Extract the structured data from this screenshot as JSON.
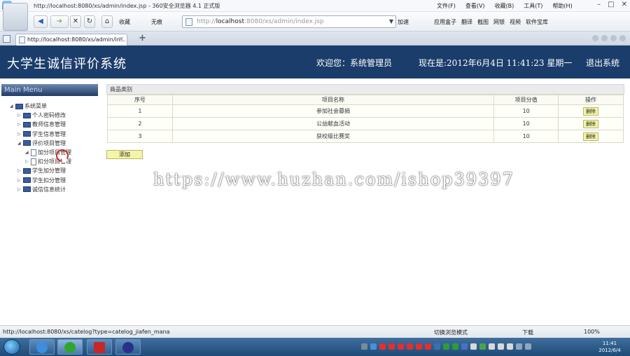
{
  "browser": {
    "window_title": "http://localhost:8080/xs/admin/index.jsp - 360安全浏览器 4.1 正式版",
    "menus": [
      "文件(F)",
      "查看(V)",
      "收藏(B)",
      "工具(T)",
      "帮助(H)"
    ],
    "nav_back_label": "收藏",
    "nav_untrace_label": "无痕",
    "address_prefix": "http://",
    "address_host": "localhost",
    "address_rest": ":8080/xs/admin/index.jsp",
    "accelerate_label": "加速",
    "tools": [
      "应用盒子",
      "翻译",
      "截图",
      "网银",
      "视频",
      "软件宝库"
    ],
    "tab_title": "http://localhost:8080/xs/admin/in...",
    "status_url": "http://localhost:8080/xs/catelog?type=catelog_jiafen_mana",
    "status_items": [
      "切换浏览模式",
      "下载",
      "100%"
    ]
  },
  "header": {
    "app_title": "大学生诚信评价系统",
    "welcome": "欢迎您：系统管理员",
    "datetime": "现在是:2012年6月4日  11:41:23 星期一",
    "logout": "退出系统"
  },
  "sidebar": {
    "menu_head": "Main Menu",
    "items": [
      {
        "label": "系统菜单"
      },
      {
        "label": "个人密码修改"
      },
      {
        "label": "教师信息管理"
      },
      {
        "label": "学生信息管理"
      },
      {
        "label": "评价项目管理"
      },
      {
        "label": "加分项目管理"
      },
      {
        "label": "扣分项目管理"
      },
      {
        "label": "学生加分管理"
      },
      {
        "label": "学生扣分管理"
      },
      {
        "label": "诚信信息统计"
      }
    ]
  },
  "content": {
    "panel_title": "商品类别",
    "columns": [
      "序号",
      "项目名称",
      "项目分值",
      "操作"
    ],
    "rows": [
      {
        "index": "1",
        "name": "参加社会募捐",
        "score": "10",
        "action": "删除"
      },
      {
        "index": "2",
        "name": "公益献血活动",
        "score": "10",
        "action": "删除"
      },
      {
        "index": "3",
        "name": "获校级比赛奖",
        "score": "10",
        "action": "删除"
      }
    ],
    "add_label": "添加"
  },
  "watermark": "https://www.huzhan.com/ishop39397",
  "taskbar": {
    "clock_time": "11:41",
    "clock_date": "2012/6/4"
  }
}
